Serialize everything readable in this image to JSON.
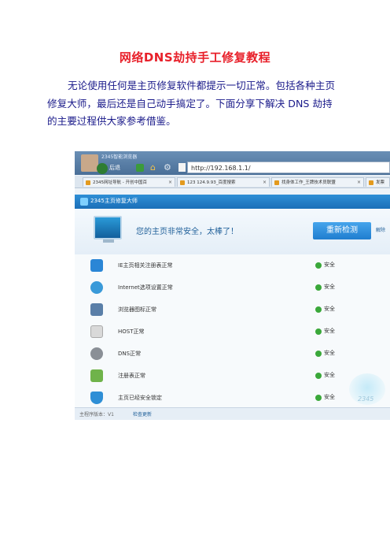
{
  "document": {
    "title": "网络DNS劫持手工修复教程",
    "paragraph": "无论使用任何是主页修复软件都提示一切正常。包括各种主页修复大师，最后还是自己动手搞定了。下面分享下解决 DNS 劫持的主要过程供大家参考借鉴。"
  },
  "screenshot": {
    "window_title": "2345智能浏览器",
    "back_label": "后退",
    "address": "http://192.168.1.1/",
    "tabs": [
      {
        "label": "2345网址导航 - 开创中国百"
      },
      {
        "label": "123 124.9.93_百度搜索"
      },
      {
        "label": "找身体工作_王牌技术员联盟"
      },
      {
        "label": "发票"
      }
    ],
    "app_title": "2345主页修复大师",
    "safe_message": "您的主页非常安全，太棒了！",
    "recheck_button": "重新检测",
    "more_link": "解除",
    "rows": [
      {
        "label": "IE主页相关注册表正常",
        "status": "安全",
        "icon": "ie-icon",
        "color": "#2a86d6"
      },
      {
        "label": "Internet选项设置正常",
        "status": "安全",
        "icon": "globe-icon",
        "color": "#3a9ad9"
      },
      {
        "label": "浏览器图标正常",
        "status": "安全",
        "icon": "monitor-icon",
        "color": "#5a7fa8"
      },
      {
        "label": "HOST正常",
        "status": "安全",
        "icon": "file-icon",
        "color": "#c9c9c9"
      },
      {
        "label": "DNS正常",
        "status": "安全",
        "icon": "gear-icon",
        "color": "#8a8f96"
      },
      {
        "label": "注册表正常",
        "status": "安全",
        "icon": "registry-icon",
        "color": "#6fb34a"
      },
      {
        "label": "主页已经安全锁定",
        "status": "安全",
        "icon": "shield-icon",
        "color": "#2f8fd6"
      }
    ],
    "footer_version": "主程序版本：V1",
    "footer_link": "检查更新",
    "mascot_text": "2345"
  }
}
